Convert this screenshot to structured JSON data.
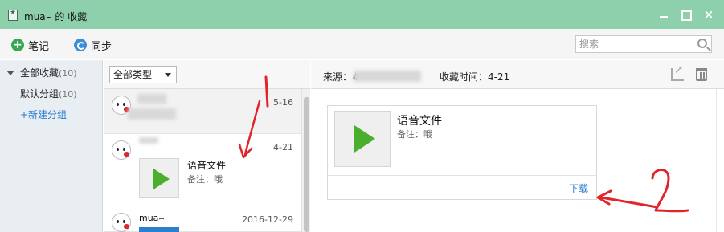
{
  "window": {
    "title": "mua⌢  的 收藏",
    "minimize": "minimize",
    "maximize": "maximize",
    "close": "×"
  },
  "toolbar": {
    "note_label": "笔记",
    "sync_label": "同步",
    "search_placeholder": "搜索"
  },
  "sidebar": {
    "all": {
      "label": "全部收藏",
      "count": "(10)"
    },
    "default": {
      "label": "默认分组",
      "count": "(10)"
    },
    "new_group": "+新建分组"
  },
  "list": {
    "type_filter": "全部类型",
    "items": [
      {
        "date": "5-16"
      },
      {
        "date": "4-21",
        "voice_title": "语音文件",
        "voice_note": "备注：哦"
      },
      {
        "name": "mua⌢",
        "date": "2016-12-29"
      }
    ]
  },
  "detail": {
    "source_label": "来源：",
    "source_value": "#",
    "time_label": "收藏时间：4-21",
    "voice_title": "语音文件",
    "voice_note": "备注：哦",
    "download": "下载"
  },
  "annotations": {
    "one": "1",
    "two": "2"
  },
  "colors": {
    "titlebar": "#8ed0ab",
    "accent_blue": "#2a7fcf",
    "play_green": "#4cae2f",
    "annotation_red": "#e0262b"
  }
}
